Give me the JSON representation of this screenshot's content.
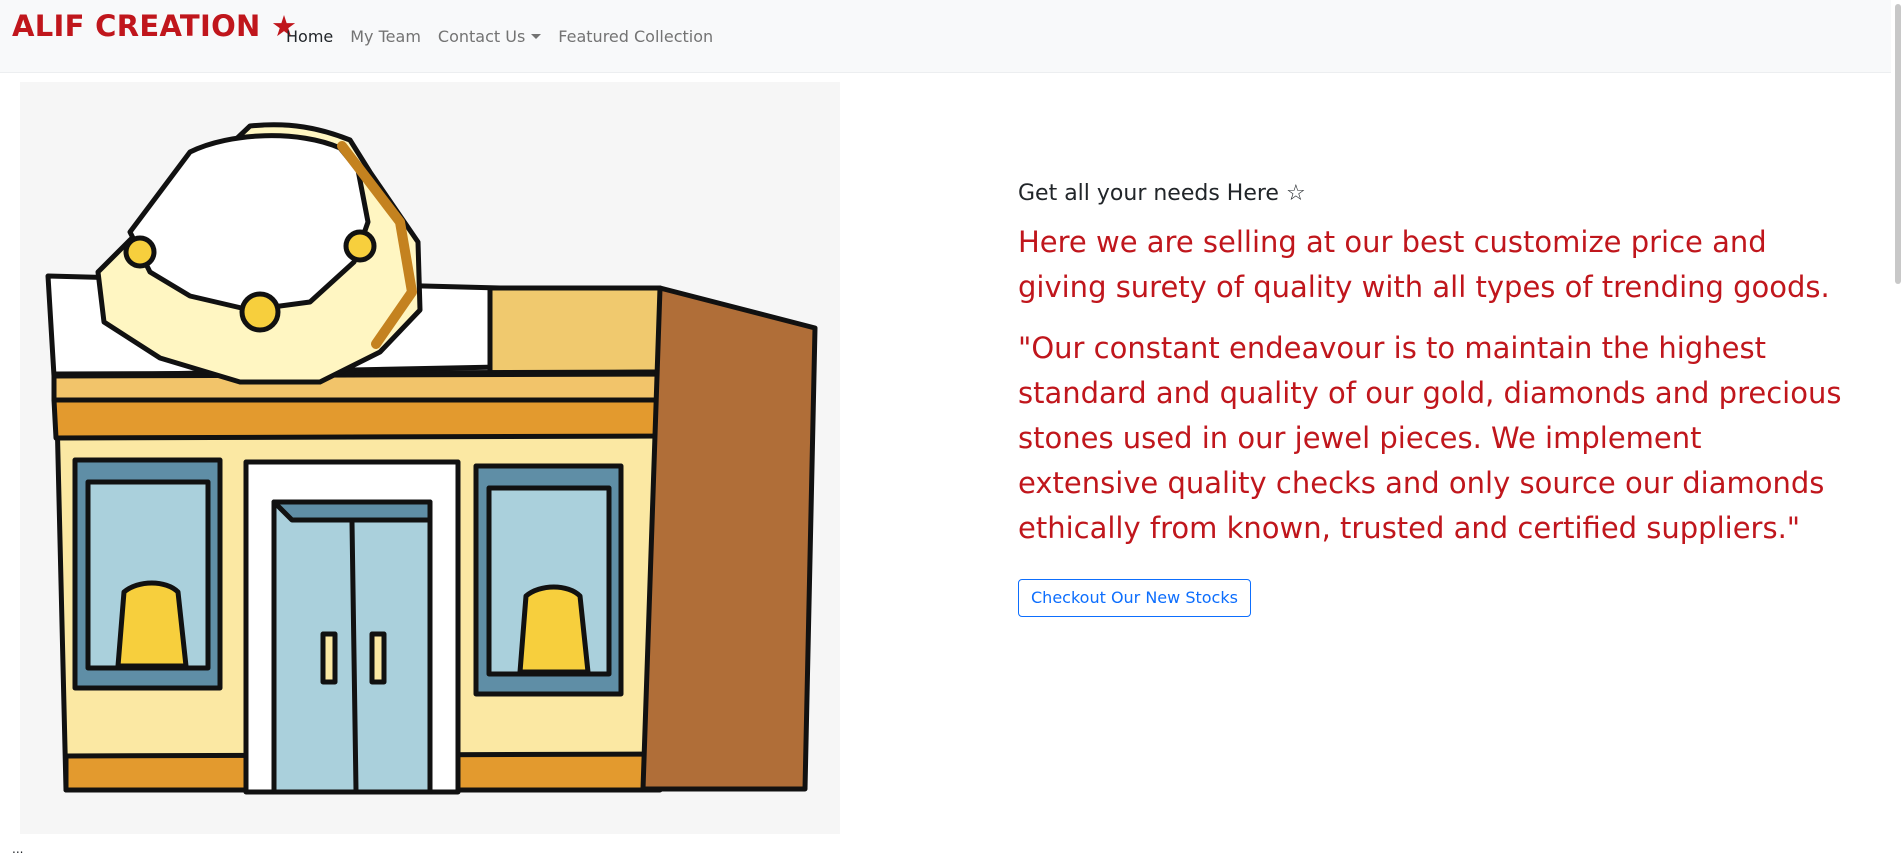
{
  "navbar": {
    "brand": "ALIF CREATION ★",
    "links": [
      {
        "label": "Home",
        "active": true
      },
      {
        "label": "My Team",
        "active": false
      },
      {
        "label": "Contact Us",
        "active": false,
        "dropdown": true
      },
      {
        "label": "Featured Collection",
        "active": false
      }
    ]
  },
  "hero": {
    "image_icon": "jewellery-shop-illustration",
    "tagline": "Get all your needs Here ☆",
    "lead": "Here we are selling at our best customize price and giving surety of quality with all types of trending goods.",
    "quote": "\"Our constant endeavour is to maintain the highest standard and quality of our gold, diamonds and precious stones used in our jewel pieces. We implement extensive quality checks and only source our diamonds ethically from known, trusted and certified suppliers.\"",
    "cta_label": "Checkout Our New Stocks"
  },
  "footer": {
    "ellipsis": "..."
  },
  "colors": {
    "brand_red": "#c0161c",
    "link_blue": "#0d6efd",
    "nav_bg": "#f8f9fa",
    "text_dark": "#212529",
    "nav_muted": "#737373"
  }
}
